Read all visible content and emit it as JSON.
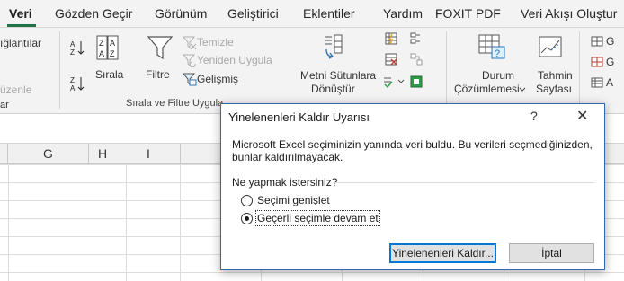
{
  "tabs": [
    {
      "label": "Veri",
      "active": true
    },
    {
      "label": "Gözden Geçir"
    },
    {
      "label": "Görünüm"
    },
    {
      "label": "Geliştirici"
    },
    {
      "label": "Eklentiler"
    },
    {
      "label": "Yardım"
    },
    {
      "label": "FOXIT PDF"
    },
    {
      "label": "Veri Akışı Oluştur"
    }
  ],
  "ribbon": {
    "connections_partial": "ığlantılar",
    "edit_partial": "üzenle",
    "group_partial_left": "ar",
    "sort_label": "Sırala",
    "filter_label": "Filtre",
    "clear_label": "Temizle",
    "reapply_label": "Yeniden Uygula",
    "advanced_label": "Gelişmiş",
    "sort_filter_group": "Sırala ve Filtre Uygula",
    "text_to_columns_line1": "Metni Sütunlara",
    "text_to_columns_line2": "Dönüştür",
    "whatif_line1": "Durum",
    "whatif_line2": "Çözümlemesi",
    "forecast_line1": "Tahmin",
    "forecast_line2": "Sayfası",
    "right_partial_1": "G",
    "right_partial_2": "G",
    "right_partial_3": "A"
  },
  "columns": [
    "G",
    "H",
    "I"
  ],
  "dialog": {
    "title": "Yinelenenleri Kaldır Uyarısı",
    "help": "?",
    "close": "✕",
    "message": "Microsoft Excel seçiminizin yanında veri buldu. Bu verileri seçmediğinizden, bunlar kaldırılmayacak.",
    "question": "Ne yapmak istersiniz?",
    "options": [
      {
        "label": "Seçimi genişlet",
        "selected": false
      },
      {
        "label": "Geçerli seçimle devam et",
        "selected": true
      }
    ],
    "remove_button": "Yinelenenleri Kaldır...",
    "cancel_button": "İptal"
  },
  "colors": {
    "accent": "#217346",
    "dialog_border": "#2b6cb0",
    "button_focus": "#0078d7"
  }
}
